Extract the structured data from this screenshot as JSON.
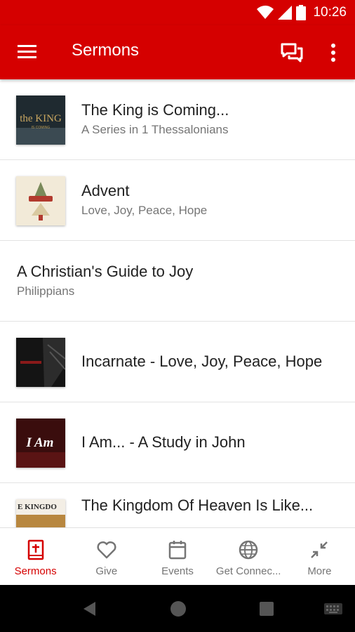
{
  "status": {
    "time": "10:26"
  },
  "app_bar": {
    "title": "Sermons"
  },
  "sermons": [
    {
      "title": "The King is Coming...",
      "subtitle": "A Series in 1 Thessalonians"
    },
    {
      "title": "Advent",
      "subtitle": "Love, Joy, Peace, Hope"
    },
    {
      "title": "A Christian's Guide to Joy",
      "subtitle": "Philippians"
    },
    {
      "title": "Incarnate - Love, Joy, Peace, Hope",
      "subtitle": ""
    },
    {
      "title": "I Am... - A Study in John",
      "subtitle": ""
    },
    {
      "title": "The Kingdom Of Heaven Is Like...",
      "subtitle": ""
    }
  ],
  "thumbnails": {
    "king_text": "the KING",
    "king_sub": "IS COMING",
    "i_am": "I Am",
    "kingdom_text": "E KINGDO"
  },
  "bottom_nav": [
    {
      "label": "Sermons",
      "icon": "bible-icon",
      "active": true
    },
    {
      "label": "Give",
      "icon": "heart-icon",
      "active": false
    },
    {
      "label": "Events",
      "icon": "calendar-icon",
      "active": false
    },
    {
      "label": "Get Connec...",
      "icon": "globe-icon",
      "active": false
    },
    {
      "label": "More",
      "icon": "collapse-icon",
      "active": false
    }
  ],
  "colors": {
    "primary": "#d50000",
    "active": "#d50000",
    "inactive": "#757575"
  }
}
